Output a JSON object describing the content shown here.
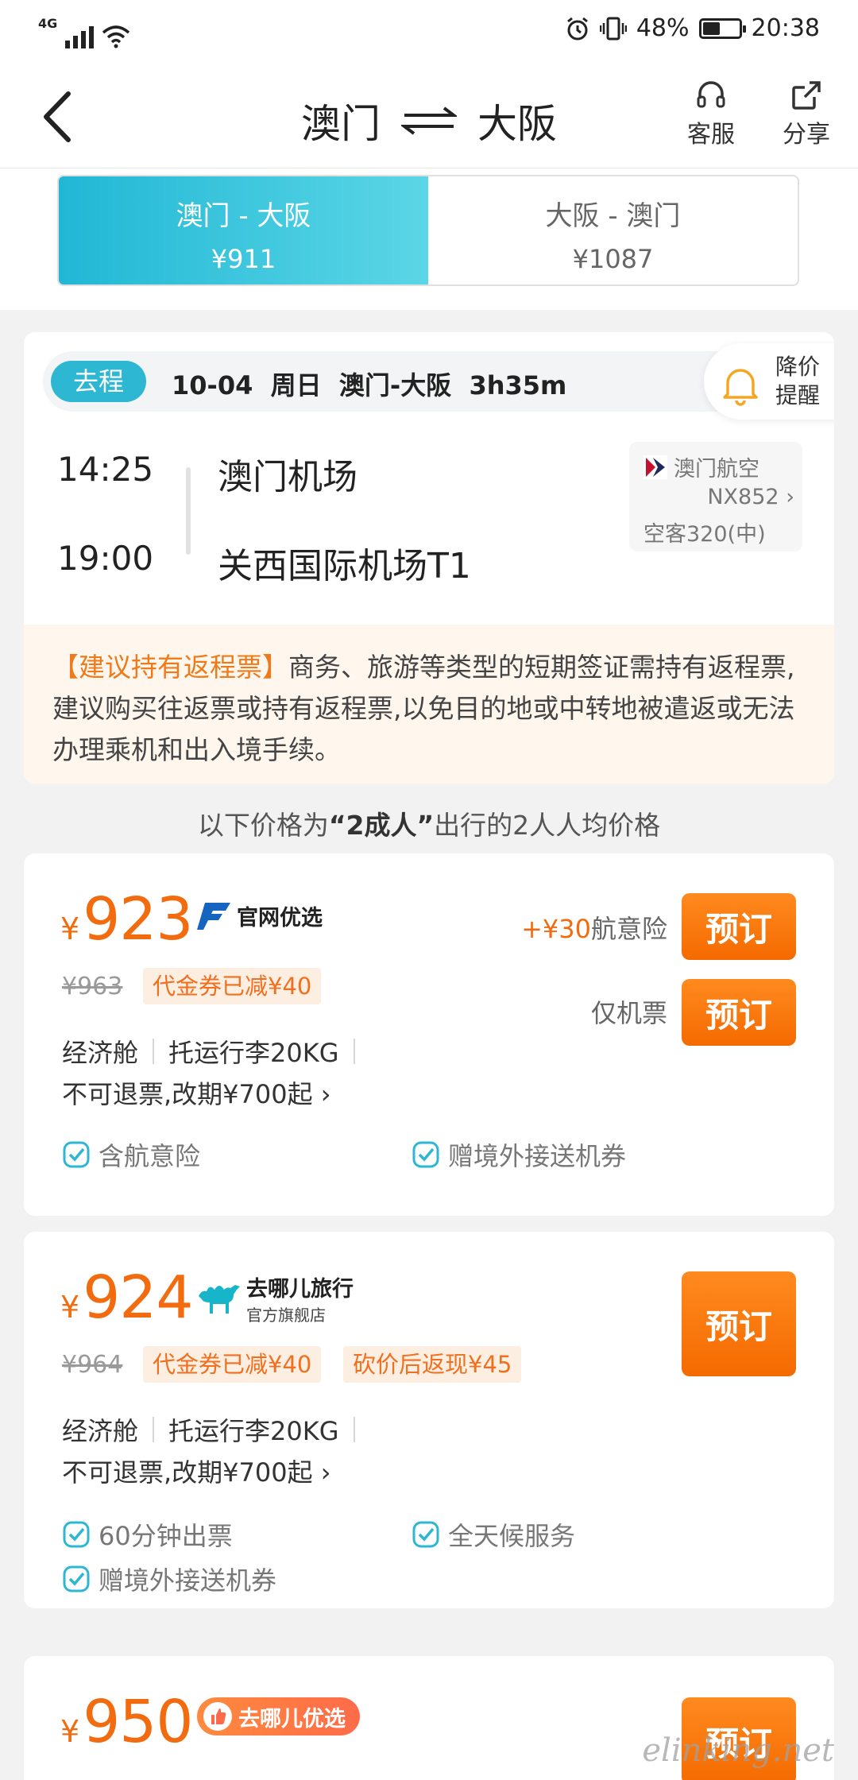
{
  "status_bar": {
    "network": "4G",
    "battery_percent": "48%",
    "battery_level": 0.48,
    "time": "20:38",
    "icons": [
      "signal-icon",
      "wifi-icon",
      "alarm-icon",
      "vibrate-icon",
      "battery-icon"
    ]
  },
  "nav": {
    "origin": "澳门",
    "destination": "大阪",
    "service_label": "客服",
    "share_label": "分享",
    "icons": [
      "back-icon",
      "swap-arrows-icon",
      "headset-icon",
      "share-icon"
    ]
  },
  "route_tabs": [
    {
      "route": "澳门 - 大阪",
      "price": "¥911",
      "active": true
    },
    {
      "route": "大阪 - 澳门",
      "price": "¥1087",
      "active": false
    }
  ],
  "flight": {
    "direction_badge": "去程",
    "summary": "10-04  周日  澳门-大阪  3h35m",
    "notify_line1": "降价",
    "notify_line2": "提醒",
    "depart_time": "14:25",
    "depart_airport": "澳门机场",
    "arrive_time": "19:00",
    "arrive_airport": "关西国际机场T1",
    "airline": "澳门航空",
    "flight_no": "NX852",
    "aircraft": "空客320(中)",
    "tip_highlight": "【建议持有返程票】",
    "tip_text": "商务、旅游等类型的短期签证需持有返程票,建议购买往返票或持有返程票,以免目的地或中转地被遣返或无法办理乘机和出入境手续。"
  },
  "price_note": {
    "prefix": "以下价格为",
    "bold": "“2成人”",
    "suffix": "出行的2人人均价格"
  },
  "offers": [
    {
      "currency": "¥",
      "price": "923",
      "seller": "官网优选",
      "original_price": "¥963",
      "tags": [
        "代金券已减¥40"
      ],
      "cabin": "经济舱",
      "baggage": "托运行李20KG",
      "rule": "不可退票,改期¥700起 ›",
      "features": [
        "含航意险",
        "赠境外接送机券"
      ],
      "option1_extra": "+¥30",
      "option1_label": "航意险",
      "option2_label": "仅机票",
      "book_label": "预订"
    },
    {
      "currency": "¥",
      "price": "924",
      "seller": "去哪儿旅行",
      "seller_sub": "官方旗舰店",
      "original_price": "¥964",
      "tags": [
        "代金券已减¥40",
        "砍价后返现¥45"
      ],
      "cabin": "经济舱",
      "baggage": "托运行李20KG",
      "rule": "不可退票,改期¥700起 ›",
      "features": [
        "60分钟出票",
        "全天候服务",
        "赠境外接送机券"
      ],
      "book_label": "预订"
    },
    {
      "currency": "¥",
      "price": "950",
      "seller": "去哪儿优选",
      "book_label": "预订"
    }
  ],
  "watermark": "elinking.net",
  "colors": {
    "accent_teal": "#21b7d5",
    "accent_orange": "#f26b0f",
    "button_orange": "#f46a00"
  }
}
